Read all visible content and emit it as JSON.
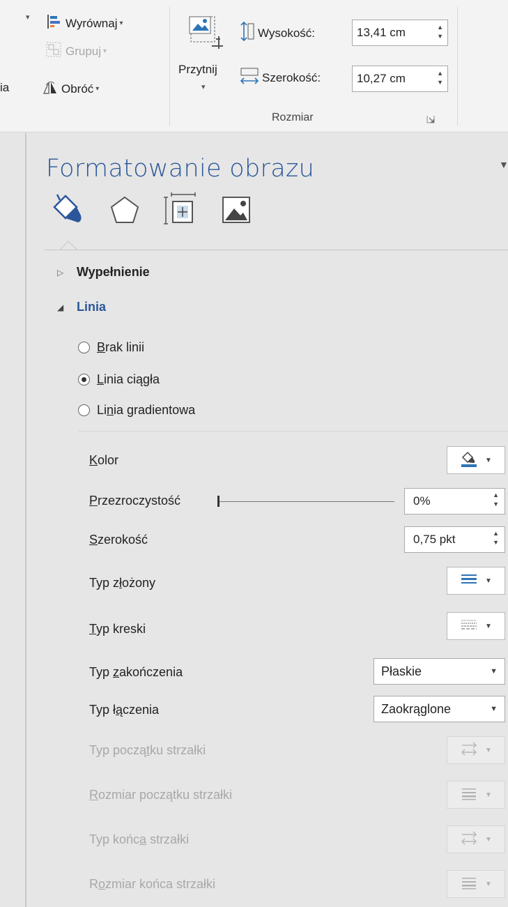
{
  "ribbon": {
    "arrange": {
      "align_label": "Wyrównaj",
      "group_label": "Grupuj",
      "rotate_label": "Obróć",
      "cut_label": "ia"
    },
    "crop_label": "Przytnij",
    "size": {
      "height_label": "Wysokość:",
      "height_value": "13,41 cm",
      "width_label": "Szerokość:",
      "width_value": "10,27 cm",
      "group_label": "Rozmiar"
    }
  },
  "pane": {
    "title": "Formatowanie obrazu",
    "tabs": [
      "fill-line-icon",
      "effects-icon",
      "size-properties-icon",
      "picture-icon"
    ],
    "sections": {
      "fill": {
        "title": "Wypełnienie"
      },
      "line": {
        "title": "Linia",
        "options": [
          {
            "pre": "",
            "key": "B",
            "post": "rak linii",
            "selected": false
          },
          {
            "pre": "",
            "key": "L",
            "post": "inia ciągła",
            "selected": true
          },
          {
            "pre": "Li",
            "key": "n",
            "post": "ia gradientowa",
            "selected": false
          }
        ]
      }
    },
    "props": {
      "color": {
        "key": "K",
        "rest": "olor",
        "accent": "#2e75b6"
      },
      "transparency": {
        "key": "P",
        "rest": "rzezroczystość",
        "value": "0%",
        "level": 0
      },
      "width": {
        "key": "S",
        "rest": "zerokość",
        "value": "0,75 pkt"
      },
      "compound": {
        "pre": "Typ z",
        "key": "ł",
        "post": "ożony"
      },
      "dash": {
        "pre": "",
        "key": "T",
        "post": "yp kreski"
      },
      "cap": {
        "pre": "Typ ",
        "key": "z",
        "post": "akończenia",
        "value": "Płaskie"
      },
      "join": {
        "pre": "Typ ł",
        "key": "ą",
        "post": "czenia",
        "value": "Zaokrąglone"
      },
      "begin_arrow_type": {
        "pre": "Typ począ",
        "key": "t",
        "post": "ku strzałki"
      },
      "begin_arrow_size": {
        "pre": "",
        "key": "R",
        "post": "ozmiar początku strzałki"
      },
      "end_arrow_type": {
        "pre": "Typ końc",
        "key": "a",
        "post": " strzałki"
      },
      "end_arrow_size": {
        "pre": "R",
        "key": "o",
        "post": "zmiar końca strzałki"
      }
    }
  }
}
